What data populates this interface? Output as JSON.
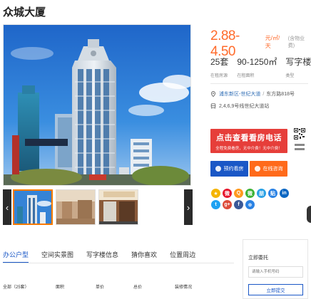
{
  "building": {
    "name": "众城大厦"
  },
  "price": {
    "range": "2.88-4.50",
    "unit": "元/㎡/天",
    "note": "(含物业费)"
  },
  "stats": [
    {
      "value": "25套",
      "label": "在租房源"
    },
    {
      "value": "90-1250㎡",
      "label": "在租面积"
    },
    {
      "value": "写字楼",
      "label": "类型"
    }
  ],
  "address": {
    "district": "浦东新区-世纪大道",
    "separator": "/",
    "street": "东方路818号"
  },
  "metro": {
    "text": "2,4,6,9号线世纪大道站"
  },
  "call": {
    "main": "点击查看看房电话",
    "sub": "全程免费看房，无中介费！无中介费！"
  },
  "actions": {
    "book": "预约看房",
    "chat": "在线咨询"
  },
  "share_icons": [
    {
      "name": "qzone-icon",
      "glyph": "★",
      "color": "#f5b400"
    },
    {
      "name": "weibo-icon",
      "glyph": "微",
      "color": "#e6162d"
    },
    {
      "name": "qq-icon",
      "glyph": "Q",
      "color": "#ff9a1f"
    },
    {
      "name": "wechat-icon",
      "glyph": "微",
      "color": "#3db336"
    },
    {
      "name": "pengyou-icon",
      "glyph": "朋",
      "color": "#27a0e5"
    },
    {
      "name": "tieba-icon",
      "glyph": "贴",
      "color": "#2a82e4"
    },
    {
      "name": "linkedin-icon",
      "glyph": "in",
      "color": "#0a66c2"
    },
    {
      "name": "twitter-icon",
      "glyph": "t",
      "color": "#1da1f2"
    },
    {
      "name": "google-plus-icon",
      "glyph": "g+",
      "color": "#dd4b39"
    },
    {
      "name": "facebook-icon",
      "glyph": "f",
      "color": "#3b5998"
    },
    {
      "name": "more-share-icon",
      "glyph": "⊕",
      "color": "#2a82e4"
    }
  ],
  "tabs": [
    {
      "label": "办公户型",
      "active": true
    },
    {
      "label": "空间实景图",
      "active": false
    },
    {
      "label": "写字楼信息",
      "active": false
    },
    {
      "label": "猜你喜欢",
      "active": false
    },
    {
      "label": "位置周边",
      "active": false
    }
  ],
  "table": {
    "headers": [
      "全部（25套）",
      "面积",
      "单价",
      "总价",
      "装修情况"
    ]
  },
  "form": {
    "title": "立即委托",
    "placeholder": "请输入手机号码",
    "submit": "立即提交"
  },
  "colors": {
    "price": "#ff6a2a",
    "call": "#e63e3a",
    "book": "#1a57c6",
    "chat": "#ff6a1a",
    "active_tab": "#1a57c6"
  }
}
